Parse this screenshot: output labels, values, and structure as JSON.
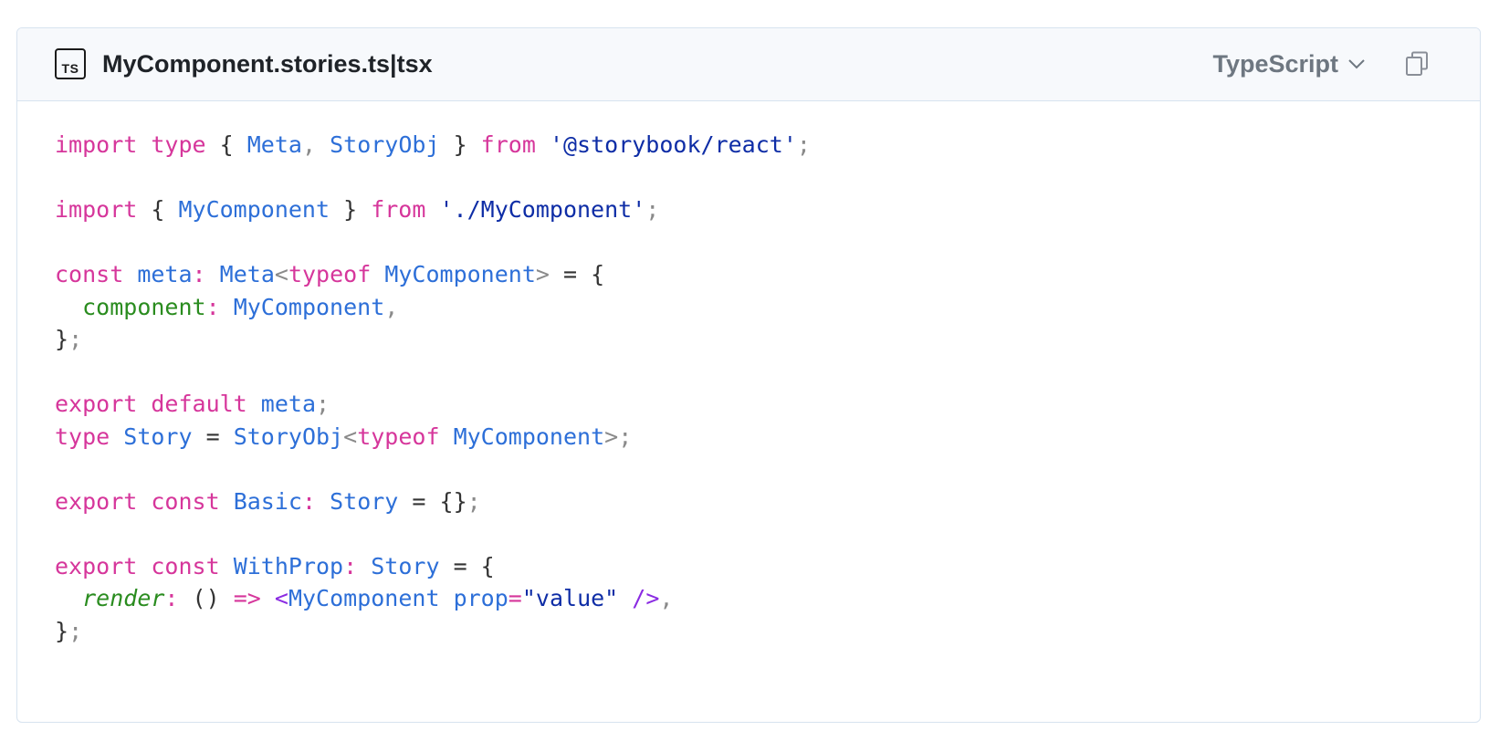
{
  "header": {
    "badge": "TS",
    "filename": "MyComponent.stories.ts|tsx",
    "language": "TypeScript",
    "language_icon": "chevron-down-icon",
    "copy_icon": "copy-icon"
  },
  "code": {
    "lines": [
      [
        [
          "kw",
          "import"
        ],
        [
          "op",
          " "
        ],
        [
          "kw",
          "type"
        ],
        [
          "op",
          " { "
        ],
        [
          "id",
          "Meta"
        ],
        [
          "pn",
          ","
        ],
        [
          "op",
          " "
        ],
        [
          "id",
          "StoryObj"
        ],
        [
          "op",
          " } "
        ],
        [
          "kw",
          "from"
        ],
        [
          "op",
          " "
        ],
        [
          "str",
          "'@storybook/react'"
        ],
        [
          "pn",
          ";"
        ]
      ],
      [],
      [
        [
          "kw",
          "import"
        ],
        [
          "op",
          " { "
        ],
        [
          "id",
          "MyComponent"
        ],
        [
          "op",
          " } "
        ],
        [
          "kw",
          "from"
        ],
        [
          "op",
          " "
        ],
        [
          "str",
          "'./MyComponent'"
        ],
        [
          "pn",
          ";"
        ]
      ],
      [],
      [
        [
          "kw",
          "const"
        ],
        [
          "op",
          " "
        ],
        [
          "id",
          "meta"
        ],
        [
          "kw",
          ":"
        ],
        [
          "op",
          " "
        ],
        [
          "id",
          "Meta"
        ],
        [
          "pn",
          "<"
        ],
        [
          "kw",
          "typeof"
        ],
        [
          "op",
          " "
        ],
        [
          "id",
          "MyComponent"
        ],
        [
          "pn",
          ">"
        ],
        [
          "op",
          " = {"
        ]
      ],
      [
        [
          "op",
          "  "
        ],
        [
          "pr",
          "component"
        ],
        [
          "kw",
          ":"
        ],
        [
          "op",
          " "
        ],
        [
          "id",
          "MyComponent"
        ],
        [
          "pn",
          ","
        ]
      ],
      [
        [
          "op",
          "}"
        ],
        [
          "pn",
          ";"
        ]
      ],
      [],
      [
        [
          "kw",
          "export"
        ],
        [
          "op",
          " "
        ],
        [
          "kw",
          "default"
        ],
        [
          "op",
          " "
        ],
        [
          "id",
          "meta"
        ],
        [
          "pn",
          ";"
        ]
      ],
      [
        [
          "kw",
          "type"
        ],
        [
          "op",
          " "
        ],
        [
          "id",
          "Story"
        ],
        [
          "op",
          " = "
        ],
        [
          "id",
          "StoryObj"
        ],
        [
          "pn",
          "<"
        ],
        [
          "kw",
          "typeof"
        ],
        [
          "op",
          " "
        ],
        [
          "id",
          "MyComponent"
        ],
        [
          "pn",
          ">"
        ],
        [
          "pn",
          ";"
        ]
      ],
      [],
      [
        [
          "kw",
          "export"
        ],
        [
          "op",
          " "
        ],
        [
          "kw",
          "const"
        ],
        [
          "op",
          " "
        ],
        [
          "id",
          "Basic"
        ],
        [
          "kw",
          ":"
        ],
        [
          "op",
          " "
        ],
        [
          "id",
          "Story"
        ],
        [
          "op",
          " = {}"
        ],
        [
          "pn",
          ";"
        ]
      ],
      [],
      [
        [
          "kw",
          "export"
        ],
        [
          "op",
          " "
        ],
        [
          "kw",
          "const"
        ],
        [
          "op",
          " "
        ],
        [
          "id",
          "WithProp"
        ],
        [
          "kw",
          ":"
        ],
        [
          "op",
          " "
        ],
        [
          "id",
          "Story"
        ],
        [
          "op",
          " = {"
        ]
      ],
      [
        [
          "op",
          "  "
        ],
        [
          "it",
          "render"
        ],
        [
          "kw",
          ":"
        ],
        [
          "op",
          " () "
        ],
        [
          "kw",
          "=>"
        ],
        [
          "op",
          " "
        ],
        [
          "jx",
          "<"
        ],
        [
          "id",
          "MyComponent"
        ],
        [
          "op",
          " "
        ],
        [
          "id",
          "prop"
        ],
        [
          "kw",
          "="
        ],
        [
          "str",
          "\"value\""
        ],
        [
          "op",
          " "
        ],
        [
          "jx",
          "/>"
        ],
        [
          "pn",
          ","
        ]
      ],
      [
        [
          "op",
          "}"
        ],
        [
          "pn",
          ";"
        ]
      ]
    ]
  }
}
